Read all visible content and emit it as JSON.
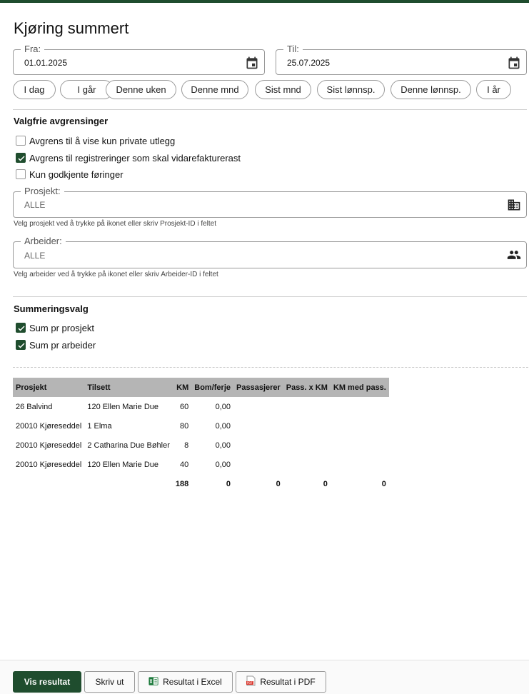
{
  "page": {
    "title": "Kjøring summert"
  },
  "period": {
    "from": {
      "label": "Fra:",
      "value": "01.01.2025"
    },
    "to": {
      "label": "Til:",
      "value": "25.07.2025"
    },
    "shortcuts": [
      "I dag",
      "I går",
      "Denne uken",
      "Denne mnd",
      "Sist mnd",
      "Sist lønnsp.",
      "Denne lønnsp.",
      "I år"
    ]
  },
  "filters": {
    "heading": "Valgfrie avgrensinger",
    "options": [
      {
        "label": "Avgrens til å vise kun private utlegg",
        "checked": false
      },
      {
        "label": "Avgrens til registreringer som skal vidarefakturerast",
        "checked": true
      },
      {
        "label": "Kun godkjente føringer",
        "checked": false
      }
    ],
    "project": {
      "label": "Prosjekt:",
      "value": "ALLE",
      "hint": "Velg prosjekt ved å trykke på ikonet eller skriv Prosjekt-ID i feltet",
      "icon": "building-icon"
    },
    "worker": {
      "label": "Arbeider:",
      "value": "ALLE",
      "hint": "Velg arbeider ved å trykke på ikonet eller skriv Arbeider-ID i feltet",
      "icon": "people-icon"
    }
  },
  "summary": {
    "heading": "Summeringsvalg",
    "options": [
      {
        "label": "Sum pr prosjekt",
        "checked": true
      },
      {
        "label": "Sum pr arbeider",
        "checked": true
      }
    ]
  },
  "table": {
    "headers": [
      "Prosjekt",
      "Tilsett",
      "KM",
      "Bom/ferje",
      "Passasjerer",
      "Pass. x KM",
      "KM med pass."
    ],
    "rows": [
      [
        "26 Balvind",
        "120 Ellen Marie Due",
        "60",
        "0,00",
        "",
        "",
        ""
      ],
      [
        "20010 Kjøreseddel",
        "1 Elma",
        "80",
        "0,00",
        "",
        "",
        ""
      ],
      [
        "20010 Kjøreseddel",
        "2 Catharina Due Bøhler",
        "8",
        "0,00",
        "",
        "",
        ""
      ],
      [
        "20010 Kjøreseddel",
        "120 Ellen Marie Due",
        "40",
        "0,00",
        "",
        "",
        ""
      ]
    ],
    "totals": [
      "",
      "",
      "188",
      "0",
      "0",
      "0",
      "0"
    ]
  },
  "footer": {
    "show_result": "Vis resultat",
    "print": "Skriv ut",
    "excel": "Resultat i Excel",
    "pdf": "Resultat i PDF"
  },
  "colors": {
    "accent": "#1f4d2e",
    "table_header": "#b5b5b5"
  }
}
